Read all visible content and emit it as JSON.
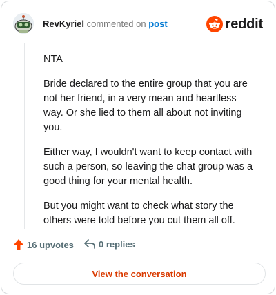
{
  "header": {
    "username": "RevKyriel",
    "action_text": "commented on",
    "post_link": "post",
    "brand": "reddit"
  },
  "comment": {
    "paragraphs": [
      "NTA",
      "Bride declared to the entire group that you are not her friend, in a very mean and heartless way. Or she lied to them all about not inviting you.",
      "Either way, I wouldn't want to keep contact with such a person, so leaving the chat group was a good thing for your mental health.",
      "But you might want to check what story the others were told before you cut them all off."
    ]
  },
  "actions": {
    "upvotes": "16 upvotes",
    "replies": "0 replies"
  },
  "footer": {
    "button_label": "View the conversation"
  },
  "colors": {
    "brand_orange": "#ff4500",
    "link_blue": "#0079d3",
    "button_text": "#d93a00"
  },
  "icons": {
    "avatar": "avatar-icon",
    "logo": "reddit-logo-icon",
    "upvote": "upvote-arrow-icon",
    "reply": "reply-arrow-icon"
  }
}
